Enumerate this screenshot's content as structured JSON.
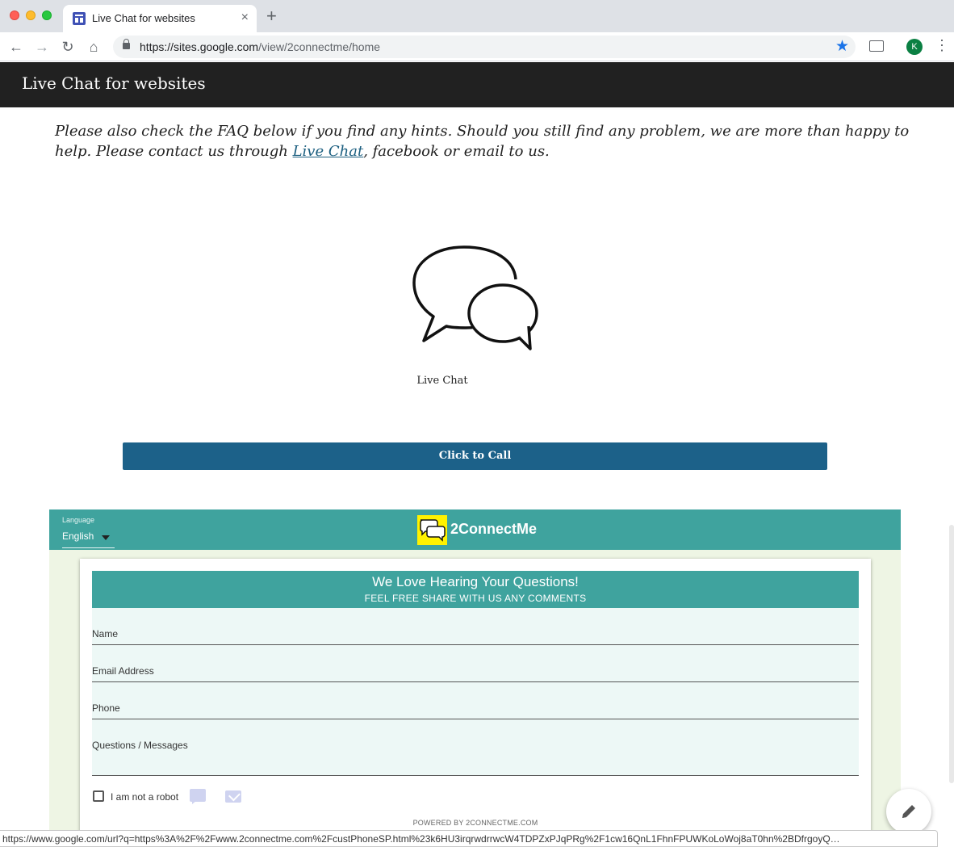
{
  "browser": {
    "tab_title": "Live Chat for websites",
    "tab_close": "×",
    "new_tab": "+",
    "url_host": "https://sites.google.com",
    "url_path": "/view/2connectme/home",
    "avatar_initial": "K",
    "back_glyph": "←",
    "forward_glyph": "→",
    "reload_glyph": "↻",
    "home_glyph": "⌂",
    "star_glyph": "★",
    "menu_glyph": "⋮"
  },
  "site": {
    "title": "Live Chat for websites",
    "intro_part1": "Please also check the FAQ below if you find any hints. Should you still find any problem, we are more than happy to help. Please contact us through ",
    "intro_link": "Live Chat",
    "intro_part2": ", facebook or email to us.",
    "chat_caption": "Live Chat",
    "call_button": "Click to Call"
  },
  "widget": {
    "language_label": "Language",
    "language_value": "English",
    "brand_name": "2ConnectMe",
    "form_title": "We Love Hearing Your Questions!",
    "form_subtitle": "FEEL FREE SHARE WITH US ANY COMMENTS",
    "fields": {
      "name": "Name",
      "email": "Email Address",
      "phone": "Phone",
      "message": "Questions / Messages"
    },
    "robot_label": "I am not a robot",
    "powered_by": "POWERED BY 2CONNECTME.COM",
    "accent_color": "#3fa39e"
  },
  "status_url": "https://www.google.com/url?q=https%3A%2F%2Fwww.2connectme.com%2FcustPhoneSP.html%23k6HU3irqrwdrrwcW4TDPZxPJqPRg%2F1cw16QnL1FhnFPUWKoLoWoj8aT0hn%2BDfrgoyQ…"
}
